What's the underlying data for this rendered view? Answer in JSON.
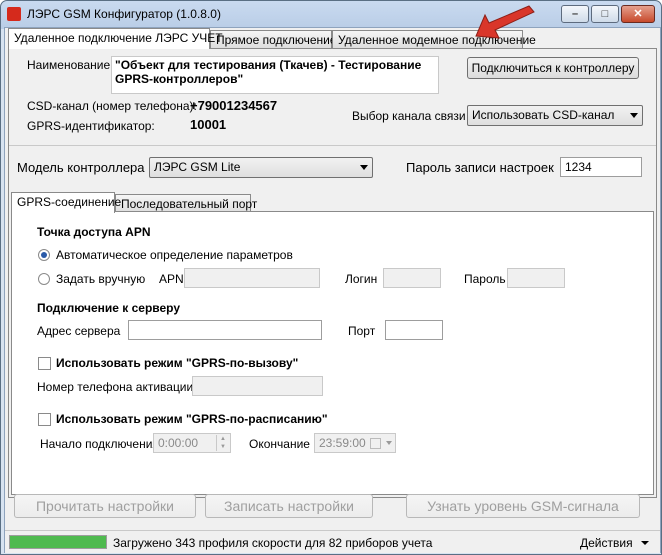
{
  "window": {
    "title": "ЛЭРС GSM Конфигуратор (1.0.8.0)",
    "minimize_glyph": "–",
    "maximize_glyph": "□",
    "close_glyph": "✕"
  },
  "tabs": [
    {
      "label": "Удаленное подключение ЛЭРС УЧЕТ",
      "active": true
    },
    {
      "label": "Прямое подключение",
      "active": false
    },
    {
      "label": "Удаленное модемное подключение",
      "active": false
    }
  ],
  "device": {
    "name_label": "Наименование:",
    "name_value": "\"Объект для тестирования (Ткачев) - Тестирование GPRS-контроллеров\"",
    "connect_button": "Подключиться к контроллеру",
    "csd_label": "CSD-канал (номер телефона):",
    "csd_value": "+79001234567",
    "gprs_id_label": "GPRS-идентификатор:",
    "gprs_id_value": "10001",
    "channel_label": "Выбор канала связи",
    "channel_value": "Использовать CSD-канал"
  },
  "controller": {
    "model_label": "Модель контроллера",
    "model_value": "ЛЭРС GSM Lite",
    "password_label": "Пароль записи настроек",
    "password_value": "1234"
  },
  "subtabs": [
    {
      "label": "GPRS-соединение",
      "active": true
    },
    {
      "label": "Последовательный порт",
      "active": false
    }
  ],
  "apn": {
    "heading": "Точка доступа APN",
    "auto_label": "Автоматическое определение параметров",
    "manual_label": "Задать вручную",
    "apn_label": "APN",
    "login_label": "Логин",
    "password_label": "Пароль",
    "apn_value": "",
    "login_value": "",
    "password_value": ""
  },
  "server": {
    "heading": "Подключение к серверу",
    "address_label": "Адрес сервера",
    "address_value": "",
    "port_label": "Порт",
    "port_value": ""
  },
  "on_call": {
    "checkbox_label": "Использовать режим \"GPRS-по-вызову\"",
    "phone_label": "Номер телефона активации",
    "phone_value": ""
  },
  "schedule": {
    "checkbox_label": "Использовать режим \"GPRS-по-расписанию\"",
    "start_label": "Начало подключения",
    "start_value": "0:00:00",
    "end_label": "Окончание",
    "end_value": "23:59:00"
  },
  "actions": {
    "read_button": "Прочитать настройки",
    "write_button": "Записать настройки",
    "signal_button": "Узнать уровень GSM-сигнала"
  },
  "status": {
    "text": "Загружено 343 профиля скорости для 82 приборов учета",
    "actions_menu": "Действия",
    "progress": 1.0,
    "progress_color": "#4fba4f"
  },
  "colors": {
    "annotation_arrow": "#d9362a"
  }
}
